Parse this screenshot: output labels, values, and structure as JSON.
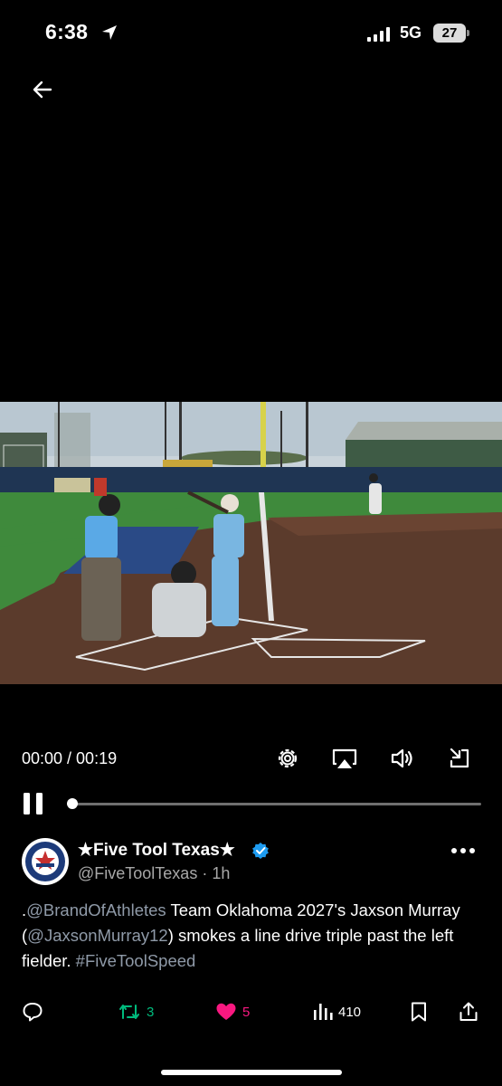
{
  "status_bar": {
    "time": "6:38",
    "network": "5G",
    "battery": "27"
  },
  "video": {
    "timecode": "00:00 / 00:19",
    "progress_fraction": 0.0,
    "controls": [
      "settings-icon",
      "airplay-icon",
      "volume-icon",
      "exit-fullscreen-icon"
    ]
  },
  "tweet": {
    "author_name": "★Five Tool Texas★",
    "handle": "@FiveToolTexas",
    "separator": " · ",
    "time_ago": "1h",
    "text": {
      "lead": ".",
      "mention1": "@BrandOfAthletes",
      "mid1": " Team Oklahoma 2027's Jaxson Murray (",
      "mention2": "@JaxsonMurray12",
      "mid2": ") smokes a line drive triple past the left fielder. ",
      "hashtag": "#FiveToolSpeed"
    },
    "retweets": "3",
    "likes": "5",
    "views": "410",
    "colors": {
      "retweet": "#00ba7c",
      "like": "#f91880",
      "verified": "#1d9bf0",
      "link": "#8f9aa8"
    }
  }
}
